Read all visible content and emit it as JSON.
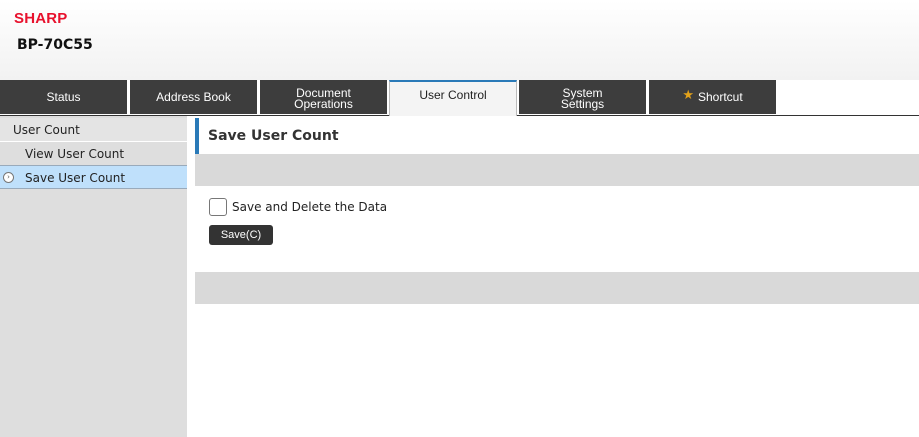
{
  "header": {
    "brand": "SHARP",
    "model": "BP-70C55"
  },
  "tabs": [
    {
      "label": "Status"
    },
    {
      "label": "Address Book"
    },
    {
      "label": "Document\nOperations"
    },
    {
      "label": "User Control",
      "active": true
    },
    {
      "label": "System\nSettings"
    },
    {
      "label": "Shortcut",
      "icon": "star-icon"
    }
  ],
  "sidebar": {
    "section": "User Count",
    "items": [
      {
        "label": "View User Count"
      },
      {
        "label": "Save User Count",
        "selected": true
      }
    ]
  },
  "main": {
    "title": "Save User Count",
    "checkbox_label": "Save and Delete the Data",
    "checkbox_checked": false,
    "save_button": "Save(C)"
  },
  "colors": {
    "brand_red": "#e8112d",
    "tab_dark": "#3d3d3d",
    "accent_blue": "#2a7ab8",
    "selected_bg": "#bfe0fb"
  }
}
